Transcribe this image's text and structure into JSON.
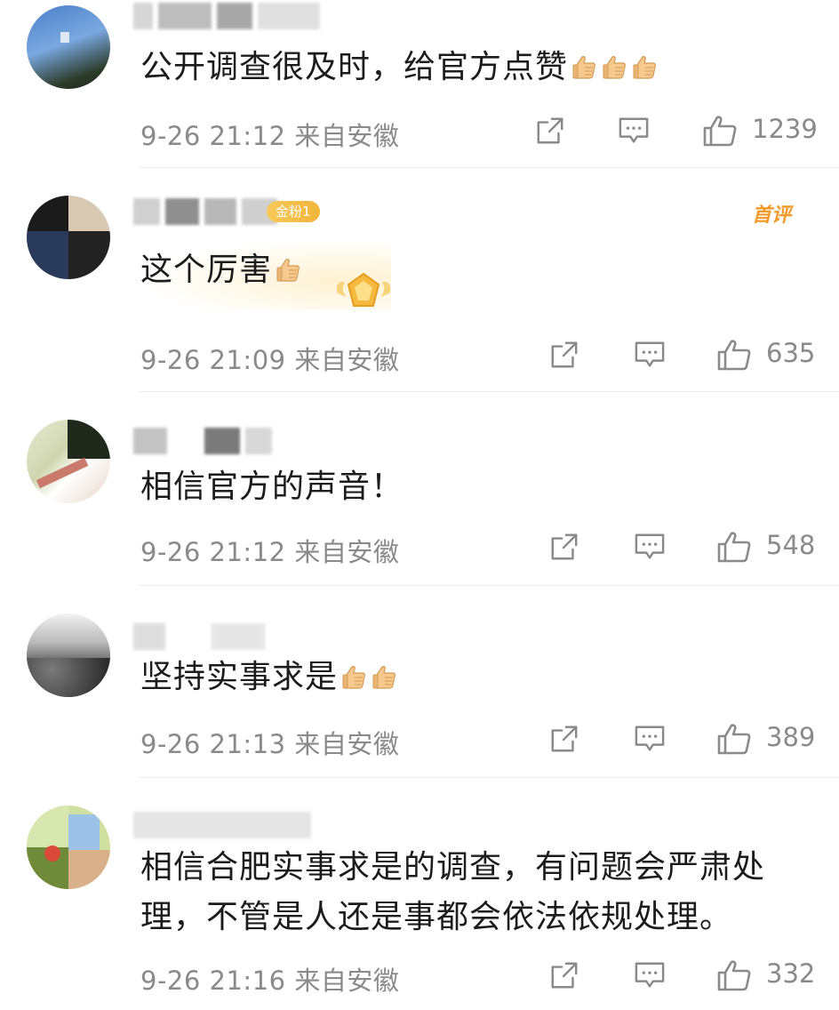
{
  "comments": [
    {
      "text": "公开调查很及时，给官方点赞",
      "thumbs": 3,
      "time": "9-26 21:12",
      "location": "来自安徽",
      "likes": "1239"
    },
    {
      "text": "这个厉害",
      "thumbs": 1,
      "badge": "金粉1",
      "tag": "首评",
      "time": "9-26 21:09",
      "location": "来自安徽",
      "likes": "635"
    },
    {
      "text": "相信官方的声音！",
      "thumbs": 0,
      "time": "9-26 21:12",
      "location": "来自安徽",
      "likes": "548"
    },
    {
      "text": "坚持实事求是",
      "thumbs": 2,
      "time": "9-26 21:13",
      "location": "来自安徽",
      "likes": "389"
    },
    {
      "text_line1": "相信合肥实事求是的调查，有问题会严肃处",
      "text_line2": "理，不管是人还是事都会依法依规处理。",
      "thumbs": 0,
      "time": "9-26 21:16",
      "location": "来自安徽",
      "likes": "332"
    }
  ],
  "icons": {
    "share": "share-icon",
    "comment": "comment-icon",
    "like": "thumb-up-icon"
  },
  "colors": {
    "meta_gray": "#8a8a8a",
    "badge_gold": "#f2b53a",
    "first_tag_orange": "#f39a2b"
  }
}
